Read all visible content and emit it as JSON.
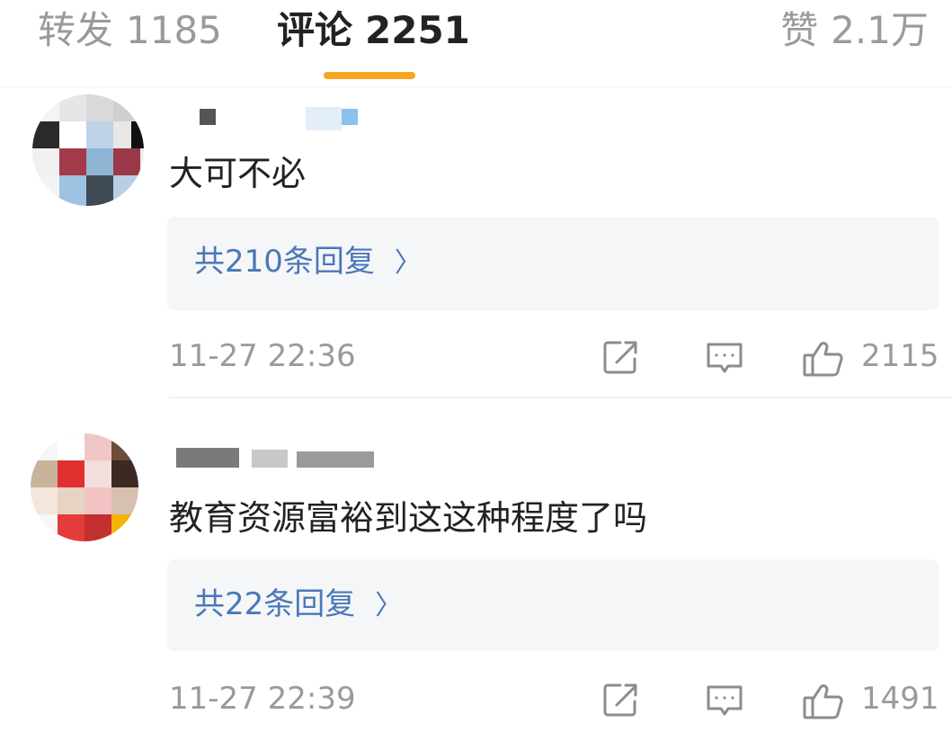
{
  "colors": {
    "tab_indicator": "#f5a623",
    "link_blue": "#4a78b8",
    "muted_text": "#9a9a9a",
    "reply_bg": "#f5f6f8"
  },
  "tabs": {
    "repost": {
      "label": "转发",
      "count": "1185"
    },
    "comments": {
      "label": "评论",
      "count": "2251"
    },
    "likes": {
      "label": "赞",
      "count": "2.1万"
    }
  },
  "comments": [
    {
      "text": "大可不必",
      "replies_label": "共210条回复",
      "timestamp": "11-27 22:36",
      "like_count": "2115",
      "icons": [
        "share-icon",
        "reply-icon",
        "like-icon"
      ]
    },
    {
      "text": "教育资源富裕到这这种程度了吗",
      "replies_label": "共22条回复",
      "timestamp": "11-27 22:39",
      "like_count": "1491",
      "icons": [
        "share-icon",
        "reply-icon",
        "like-icon"
      ]
    }
  ],
  "icons": {
    "chevron": "chevron-right-icon"
  }
}
